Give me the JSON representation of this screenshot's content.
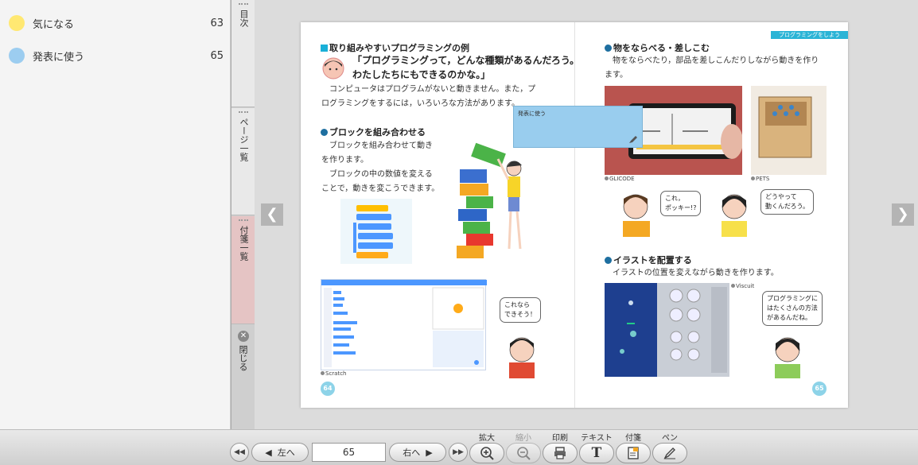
{
  "sticky_list": [
    {
      "label": "気になる",
      "count": "63",
      "color": "#ffe872"
    },
    {
      "label": "発表に使う",
      "count": "65",
      "color": "#9ccdf0"
    }
  ],
  "tabs": {
    "contents": "目次",
    "page_list": "ページ一覧",
    "sticky_list": "付箋一覧",
    "close": "閉じる"
  },
  "book": {
    "left": {
      "heading": "取り組みやすいプログラミングの例",
      "quote_line1": "「プログラミングって，どんな種類があるんだろう。",
      "quote_line2": "わたしたちにもできるのかな。」",
      "intro_line1": "コンピュータはプログラムがないと動きません。また，プ",
      "intro_line2": "ログラミングをするには，いろいろな方法があります。",
      "section1_title": "ブロックを組み合わせる",
      "section1_line1": "ブロックを組み合わせて動き",
      "section1_line2": "を作ります。",
      "section1_line3": "ブロックの中の数値を変える",
      "section1_line4": "ことで，動きを変こうできます。",
      "caption_scratch": "Scratch",
      "bubble_text1": "これなら",
      "bubble_text2": "できそう！",
      "page_number": "64"
    },
    "right": {
      "banner": "プログラミングをしよう",
      "section2_title": "物をならべる・差しこむ",
      "section2_line1": "物をならべたり，部品を差しこんだりしながら動きを作り",
      "section2_line2": "ます。",
      "caption_glicode": "GLICODE",
      "caption_pets": "PETS",
      "bubble_boy1": "これ，",
      "bubble_boy2": "ポッキー!?",
      "bubble_girl1": "どうやって",
      "bubble_girl2": "動くんだろう。",
      "section3_title": "イラストを配置する",
      "section3_line1": "イラストの位置を変えながら動きを作ります。",
      "caption_viscuit": "Viscuit",
      "bubble_girl3_1": "プログラミングに",
      "bubble_girl3_2": "はたくさんの方法",
      "bubble_girl3_3": "があるんだね。",
      "page_number": "65"
    }
  },
  "sticky_note": {
    "text": "発表に使う"
  },
  "toolbar": {
    "first_icon": "double-left-icon",
    "prev_label": "左へ",
    "page_value": "65",
    "next_label": "右へ",
    "last_icon": "double-right-icon",
    "zoom_in_label": "拡大",
    "zoom_out_label": "縮小",
    "print_label": "印刷",
    "text_label": "テキスト",
    "sticky_label": "付箋",
    "pen_label": "ペン"
  }
}
